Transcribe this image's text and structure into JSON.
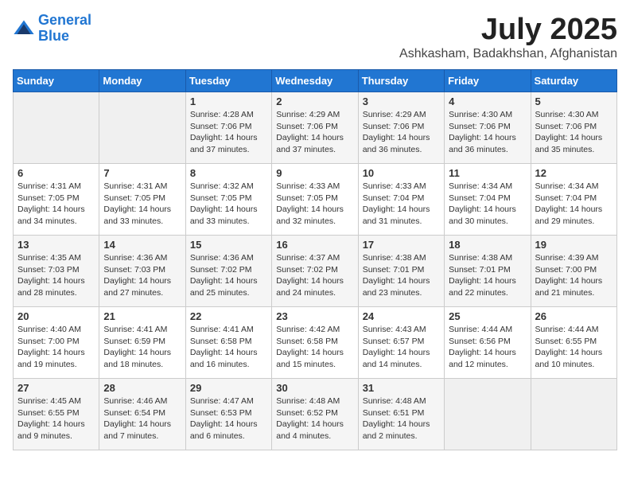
{
  "header": {
    "logo_line1": "General",
    "logo_line2": "Blue",
    "month_year": "July 2025",
    "location": "Ashkasham, Badakhshan, Afghanistan"
  },
  "days_of_week": [
    "Sunday",
    "Monday",
    "Tuesday",
    "Wednesday",
    "Thursday",
    "Friday",
    "Saturday"
  ],
  "weeks": [
    [
      {
        "day": "",
        "details": ""
      },
      {
        "day": "",
        "details": ""
      },
      {
        "day": "1",
        "sunrise": "4:28 AM",
        "sunset": "7:06 PM",
        "daylight": "14 hours and 37 minutes."
      },
      {
        "day": "2",
        "sunrise": "4:29 AM",
        "sunset": "7:06 PM",
        "daylight": "14 hours and 37 minutes."
      },
      {
        "day": "3",
        "sunrise": "4:29 AM",
        "sunset": "7:06 PM",
        "daylight": "14 hours and 36 minutes."
      },
      {
        "day": "4",
        "sunrise": "4:30 AM",
        "sunset": "7:06 PM",
        "daylight": "14 hours and 36 minutes."
      },
      {
        "day": "5",
        "sunrise": "4:30 AM",
        "sunset": "7:06 PM",
        "daylight": "14 hours and 35 minutes."
      }
    ],
    [
      {
        "day": "6",
        "sunrise": "4:31 AM",
        "sunset": "7:05 PM",
        "daylight": "14 hours and 34 minutes."
      },
      {
        "day": "7",
        "sunrise": "4:31 AM",
        "sunset": "7:05 PM",
        "daylight": "14 hours and 33 minutes."
      },
      {
        "day": "8",
        "sunrise": "4:32 AM",
        "sunset": "7:05 PM",
        "daylight": "14 hours and 33 minutes."
      },
      {
        "day": "9",
        "sunrise": "4:33 AM",
        "sunset": "7:05 PM",
        "daylight": "14 hours and 32 minutes."
      },
      {
        "day": "10",
        "sunrise": "4:33 AM",
        "sunset": "7:04 PM",
        "daylight": "14 hours and 31 minutes."
      },
      {
        "day": "11",
        "sunrise": "4:34 AM",
        "sunset": "7:04 PM",
        "daylight": "14 hours and 30 minutes."
      },
      {
        "day": "12",
        "sunrise": "4:34 AM",
        "sunset": "7:04 PM",
        "daylight": "14 hours and 29 minutes."
      }
    ],
    [
      {
        "day": "13",
        "sunrise": "4:35 AM",
        "sunset": "7:03 PM",
        "daylight": "14 hours and 28 minutes."
      },
      {
        "day": "14",
        "sunrise": "4:36 AM",
        "sunset": "7:03 PM",
        "daylight": "14 hours and 27 minutes."
      },
      {
        "day": "15",
        "sunrise": "4:36 AM",
        "sunset": "7:02 PM",
        "daylight": "14 hours and 25 minutes."
      },
      {
        "day": "16",
        "sunrise": "4:37 AM",
        "sunset": "7:02 PM",
        "daylight": "14 hours and 24 minutes."
      },
      {
        "day": "17",
        "sunrise": "4:38 AM",
        "sunset": "7:01 PM",
        "daylight": "14 hours and 23 minutes."
      },
      {
        "day": "18",
        "sunrise": "4:38 AM",
        "sunset": "7:01 PM",
        "daylight": "14 hours and 22 minutes."
      },
      {
        "day": "19",
        "sunrise": "4:39 AM",
        "sunset": "7:00 PM",
        "daylight": "14 hours and 21 minutes."
      }
    ],
    [
      {
        "day": "20",
        "sunrise": "4:40 AM",
        "sunset": "7:00 PM",
        "daylight": "14 hours and 19 minutes."
      },
      {
        "day": "21",
        "sunrise": "4:41 AM",
        "sunset": "6:59 PM",
        "daylight": "14 hours and 18 minutes."
      },
      {
        "day": "22",
        "sunrise": "4:41 AM",
        "sunset": "6:58 PM",
        "daylight": "14 hours and 16 minutes."
      },
      {
        "day": "23",
        "sunrise": "4:42 AM",
        "sunset": "6:58 PM",
        "daylight": "14 hours and 15 minutes."
      },
      {
        "day": "24",
        "sunrise": "4:43 AM",
        "sunset": "6:57 PM",
        "daylight": "14 hours and 14 minutes."
      },
      {
        "day": "25",
        "sunrise": "4:44 AM",
        "sunset": "6:56 PM",
        "daylight": "14 hours and 12 minutes."
      },
      {
        "day": "26",
        "sunrise": "4:44 AM",
        "sunset": "6:55 PM",
        "daylight": "14 hours and 10 minutes."
      }
    ],
    [
      {
        "day": "27",
        "sunrise": "4:45 AM",
        "sunset": "6:55 PM",
        "daylight": "14 hours and 9 minutes."
      },
      {
        "day": "28",
        "sunrise": "4:46 AM",
        "sunset": "6:54 PM",
        "daylight": "14 hours and 7 minutes."
      },
      {
        "day": "29",
        "sunrise": "4:47 AM",
        "sunset": "6:53 PM",
        "daylight": "14 hours and 6 minutes."
      },
      {
        "day": "30",
        "sunrise": "4:48 AM",
        "sunset": "6:52 PM",
        "daylight": "14 hours and 4 minutes."
      },
      {
        "day": "31",
        "sunrise": "4:48 AM",
        "sunset": "6:51 PM",
        "daylight": "14 hours and 2 minutes."
      },
      {
        "day": "",
        "details": ""
      },
      {
        "day": "",
        "details": ""
      }
    ]
  ],
  "labels": {
    "sunrise_prefix": "Sunrise: ",
    "sunset_prefix": "Sunset: ",
    "daylight_prefix": "Daylight: "
  }
}
